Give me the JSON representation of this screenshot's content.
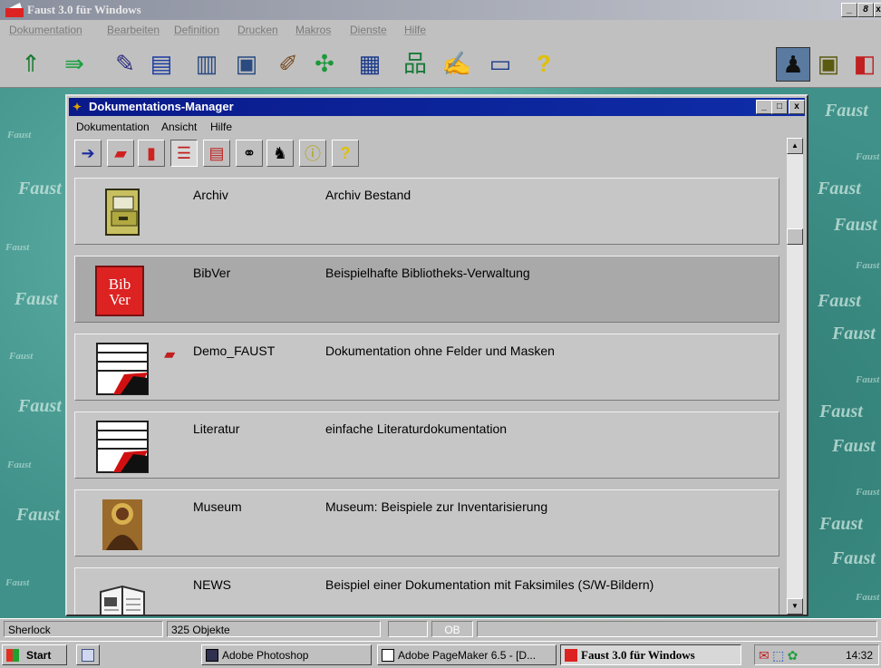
{
  "app": {
    "title": "Faust 3.0 für Windows",
    "menu": [
      "Dokumentation",
      "Bearbeiten",
      "Definition",
      "Drucken",
      "Makros",
      "Dienste",
      "Hilfe"
    ],
    "window_buttons": [
      "_",
      " 8",
      "x"
    ]
  },
  "workspace": {
    "watermark": "Faust"
  },
  "doc_manager": {
    "title": "Dokumentations-Manager",
    "menu": [
      "Dokumentation",
      "Ansicht",
      "Hilfe"
    ],
    "rows": [
      {
        "name": "Archiv",
        "description": "Archiv Bestand",
        "icon": "archive-cabinet-icon"
      },
      {
        "name": "BibVer",
        "description": "Beispielhafte Bibliotheks-Verwaltung",
        "icon": "bibver-book-icon",
        "icon_text_1": "Bib",
        "icon_text_2": "Ver",
        "selected": true
      },
      {
        "name": "Demo_FAUST",
        "description": "Dokumentation ohne Felder und Masken",
        "icon": "faust-document-icon"
      },
      {
        "name": "Literatur",
        "description": "einfache Literaturdokumentation",
        "icon": "faust-document-icon"
      },
      {
        "name": "Museum",
        "description": "Museum: Beispiele zur Inventarisierung",
        "icon": "icon-painting-icon"
      },
      {
        "name": "NEWS",
        "description": "Beispiel einer Dokumentation mit Faksimiles (S/W-Bildern)",
        "icon": "newspaper-icon"
      }
    ]
  },
  "statusbar": {
    "search": "Sherlock",
    "count": "325 Objekte",
    "indicator": "OB"
  },
  "taskbar": {
    "start": "Start",
    "tasks": [
      "Adobe Photoshop",
      "Adobe PageMaker 6.5 - [D...",
      "Faust 3.0 für Windows"
    ],
    "clock": "14:32"
  },
  "colors": {
    "workspace": "#3f9189",
    "dm_title": "#0a1a8a",
    "selected_row": "#a9a9a9"
  }
}
